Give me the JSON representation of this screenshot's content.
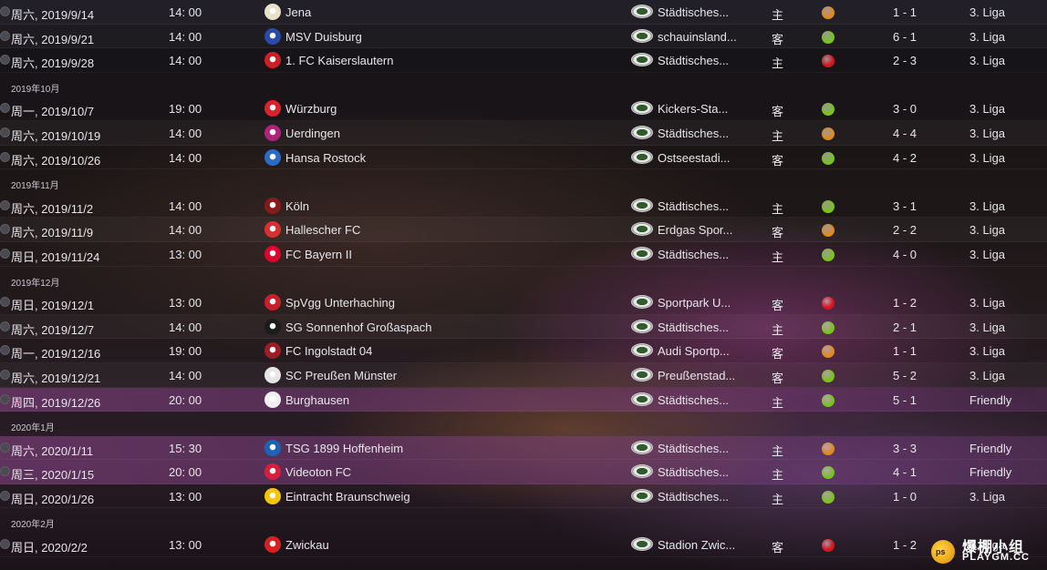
{
  "fixtures": [
    {
      "type": "match",
      "date": "周六, 2019/9/14",
      "time": "14: 00",
      "team": "Jena",
      "stadium": "Städtisches...",
      "venue": "主",
      "result_color": "#e08a1e",
      "score": "1 - 1",
      "competition": "3. Liga",
      "crest_color": "#e8e0c8",
      "style": "selected"
    },
    {
      "type": "match",
      "date": "周六, 2019/9/21",
      "time": "14: 00",
      "team": "MSV Duisburg",
      "stadium": "schauinsland...",
      "venue": "客",
      "result_color": "#7ac21e",
      "score": "6 - 1",
      "competition": "3. Liga",
      "crest_color": "#2b4aa8",
      "style": "alt"
    },
    {
      "type": "match",
      "date": "周六, 2019/9/28",
      "time": "14: 00",
      "team": "1. FC Kaiserslautern",
      "stadium": "Städtisches...",
      "venue": "主",
      "result_color": "#d8141e",
      "score": "2 - 3",
      "competition": "3. Liga",
      "crest_color": "#d01c24",
      "style": ""
    },
    {
      "type": "month",
      "label": "2019年10月"
    },
    {
      "type": "match",
      "date": "周一, 2019/10/7",
      "time": "19: 00",
      "team": "Würzburg",
      "stadium": "Kickers-Sta...",
      "venue": "客",
      "result_color": "#7ac21e",
      "score": "3 - 0",
      "competition": "3. Liga",
      "crest_color": "#d8232a",
      "style": ""
    },
    {
      "type": "match",
      "date": "周六, 2019/10/19",
      "time": "14: 00",
      "team": "Uerdingen",
      "stadium": "Städtisches...",
      "venue": "主",
      "result_color": "#e08a1e",
      "score": "4 - 4",
      "competition": "3. Liga",
      "crest_color": "#b0237a",
      "style": "alt"
    },
    {
      "type": "match",
      "date": "周六, 2019/10/26",
      "time": "14: 00",
      "team": "Hansa Rostock",
      "stadium": "Ostseestadi...",
      "venue": "客",
      "result_color": "#7ac21e",
      "score": "4 - 2",
      "competition": "3. Liga",
      "crest_color": "#2a6ac8",
      "style": ""
    },
    {
      "type": "month",
      "label": "2019年11月"
    },
    {
      "type": "match",
      "date": "周六, 2019/11/2",
      "time": "14: 00",
      "team": "Köln",
      "stadium": "Städtisches...",
      "venue": "主",
      "result_color": "#7ac21e",
      "score": "3 - 1",
      "competition": "3. Liga",
      "crest_color": "#8a1a1a",
      "style": ""
    },
    {
      "type": "match",
      "date": "周六, 2019/11/9",
      "time": "14: 00",
      "team": "Hallescher FC",
      "stadium": "Erdgas Spor...",
      "venue": "客",
      "result_color": "#e08a1e",
      "score": "2 - 2",
      "competition": "3. Liga",
      "crest_color": "#d83030",
      "style": "alt"
    },
    {
      "type": "match",
      "date": "周日, 2019/11/24",
      "time": "13: 00",
      "team": "FC Bayern II",
      "stadium": "Städtisches...",
      "venue": "主",
      "result_color": "#7ac21e",
      "score": "4 - 0",
      "competition": "3. Liga",
      "crest_color": "#dc052d",
      "style": ""
    },
    {
      "type": "month",
      "label": "2019年12月"
    },
    {
      "type": "match",
      "date": "周日, 2019/12/1",
      "time": "13: 00",
      "team": "SpVgg Unterhaching",
      "stadium": "Sportpark U...",
      "venue": "客",
      "result_color": "#d8141e",
      "score": "1 - 2",
      "competition": "3. Liga",
      "crest_color": "#c8202a",
      "style": ""
    },
    {
      "type": "match",
      "date": "周六, 2019/12/7",
      "time": "14: 00",
      "team": "SG Sonnenhof Großaspach",
      "stadium": "Städtisches...",
      "venue": "主",
      "result_color": "#7ac21e",
      "score": "2 - 1",
      "competition": "3. Liga",
      "crest_color": "#1c1c1c",
      "style": "alt"
    },
    {
      "type": "match",
      "date": "周一, 2019/12/16",
      "time": "19: 00",
      "team": "FC Ingolstadt 04",
      "stadium": "Audi Sportp...",
      "venue": "客",
      "result_color": "#e08a1e",
      "score": "1 - 1",
      "competition": "3. Liga",
      "crest_color": "#a01c24",
      "style": ""
    },
    {
      "type": "match",
      "date": "周六, 2019/12/21",
      "time": "14: 00",
      "team": "SC Preußen Münster",
      "stadium": "Preußenstad...",
      "venue": "客",
      "result_color": "#7ac21e",
      "score": "5 - 2",
      "competition": "3. Liga",
      "crest_color": "#e6e6e6",
      "style": "alt"
    },
    {
      "type": "match",
      "date": "周四, 2019/12/26",
      "time": "20: 00",
      "team": "Burghausen",
      "stadium": "Städtisches...",
      "venue": "主",
      "result_color": "#7ac21e",
      "score": "5 - 1",
      "competition": "Friendly",
      "crest_color": "#f0f0f0",
      "style": "friendly"
    },
    {
      "type": "month",
      "label": "2020年1月"
    },
    {
      "type": "match",
      "date": "周六, 2020/1/11",
      "time": "15: 30",
      "team": "TSG 1899 Hoffenheim",
      "stadium": "Städtisches...",
      "venue": "主",
      "result_color": "#e08a1e",
      "score": "3 - 3",
      "competition": "Friendly",
      "crest_color": "#1c63b7",
      "style": "friendly"
    },
    {
      "type": "match",
      "date": "周三, 2020/1/15",
      "time": "20: 00",
      "team": "Videoton FC",
      "stadium": "Städtisches...",
      "venue": "主",
      "result_color": "#7ac21e",
      "score": "4 - 1",
      "competition": "Friendly",
      "crest_color": "#d81e3c",
      "style": "friendly"
    },
    {
      "type": "match",
      "date": "周日, 2020/1/26",
      "time": "13: 00",
      "team": "Eintracht Braunschweig",
      "stadium": "Städtisches...",
      "venue": "主",
      "result_color": "#7ac21e",
      "score": "1 - 0",
      "competition": "3. Liga",
      "crest_color": "#f2c500",
      "style": ""
    },
    {
      "type": "month",
      "label": "2020年2月"
    },
    {
      "type": "match",
      "date": "周日, 2020/2/2",
      "time": "13: 00",
      "team": "Zwickau",
      "stadium": "Stadion Zwic...",
      "venue": "客",
      "result_color": "#d8141e",
      "score": "1 - 2",
      "competition": "3. Liga",
      "crest_color": "#d82020",
      "style": ""
    }
  ],
  "watermark": {
    "text_cn": "爆棚小组",
    "text_en": "PLAYGM.CC",
    "ball_text": "ps"
  }
}
